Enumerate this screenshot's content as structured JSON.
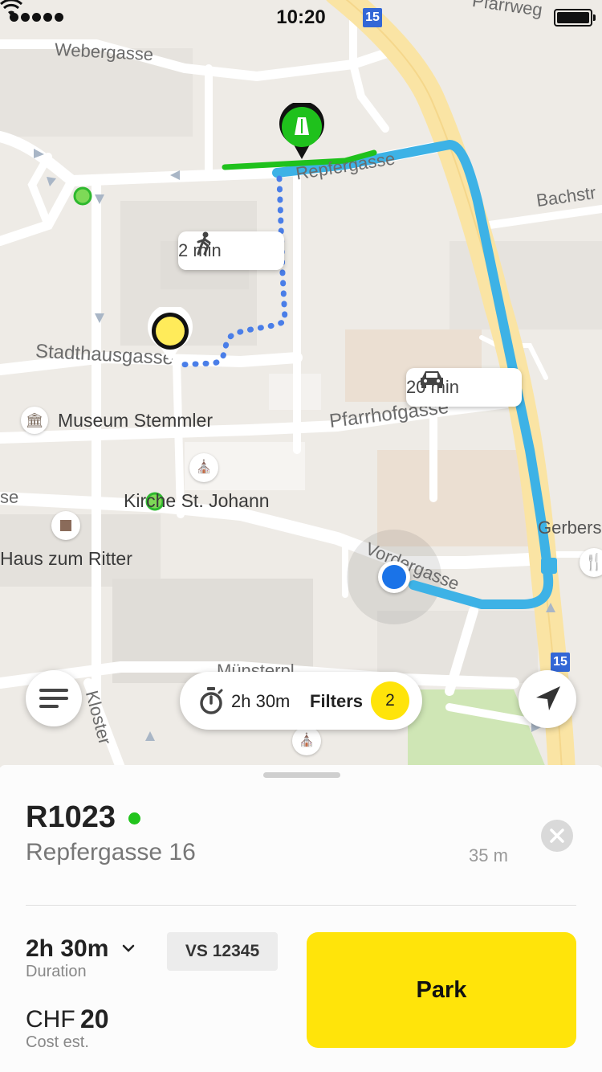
{
  "status_bar": {
    "time": "10:20"
  },
  "map": {
    "streets": {
      "webergasse": "Webergasse",
      "repfergasse": "Repfergasse",
      "bachstr": "Bachstr",
      "pfarrweg": "Pfarrweg",
      "stadthausgasse": "Stadthausgasse",
      "pfarrhofgasse": "Pfarrhofgasse",
      "vordergasse": "Vordergasse",
      "gerberstr": "Gerbers",
      "muensterpl": "Münsterpl",
      "klosterstr": "Kloster",
      "left_cut": "se"
    },
    "pois": {
      "museum": "Museum Stemmler",
      "kirche": "Kirche St. Johann",
      "haus": "Haus zum Ritter"
    },
    "road_shields": [
      "15",
      "15"
    ],
    "walk_bubble": {
      "icon": "walk-icon",
      "text": "2 min"
    },
    "drive_bubble": {
      "icon": "car-icon",
      "text": "20 min"
    }
  },
  "controls": {
    "duration": "2h 30m",
    "filters_label": "Filters",
    "filters_count": "2"
  },
  "sheet": {
    "zone_id": "R1023",
    "address": "Repfergasse 16",
    "distance": "35 m",
    "duration_value": "2h 30m",
    "duration_label": "Duration",
    "plate": "VS 12345",
    "currency": "CHF",
    "amount": "20",
    "cost_label": "Cost est.",
    "park_label": "Park"
  },
  "colors": {
    "accent_yellow": "#FFE40A",
    "route_blue": "#3DB2E6",
    "user_dot": "#1A73E8",
    "zone_green": "#22C41D"
  }
}
